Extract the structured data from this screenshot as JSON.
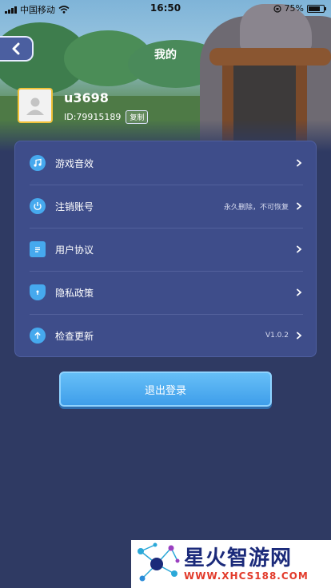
{
  "status_bar": {
    "carrier": "中国移动",
    "time": "16:50",
    "battery": "75%",
    "battery_level": 0.75
  },
  "header": {
    "title": "我的"
  },
  "profile": {
    "username": "u3698",
    "uid": "ID:79915189",
    "copy_label": "复制"
  },
  "menu": {
    "items": [
      {
        "label": "游戏音效",
        "right": "",
        "icon": "music-note-icon"
      },
      {
        "label": "注销账号",
        "right": "永久删除，不可恢复",
        "icon": "power-icon"
      },
      {
        "label": "用户协议",
        "right": "",
        "icon": "document-icon"
      },
      {
        "label": "隐私政策",
        "right": "",
        "icon": "shield-icon"
      },
      {
        "label": "检查更新",
        "right": "V1.0.2",
        "icon": "arrow-up-icon"
      }
    ]
  },
  "logout": {
    "label": "退出登录"
  },
  "watermark": {
    "title": "星火智游网",
    "url": "WWW.XHCS188.COM"
  },
  "colors": {
    "background": "#2f3a63",
    "card": "#3e4d8a",
    "accent_blue": "#46a9ee",
    "avatar_border": "#f2c23a"
  }
}
